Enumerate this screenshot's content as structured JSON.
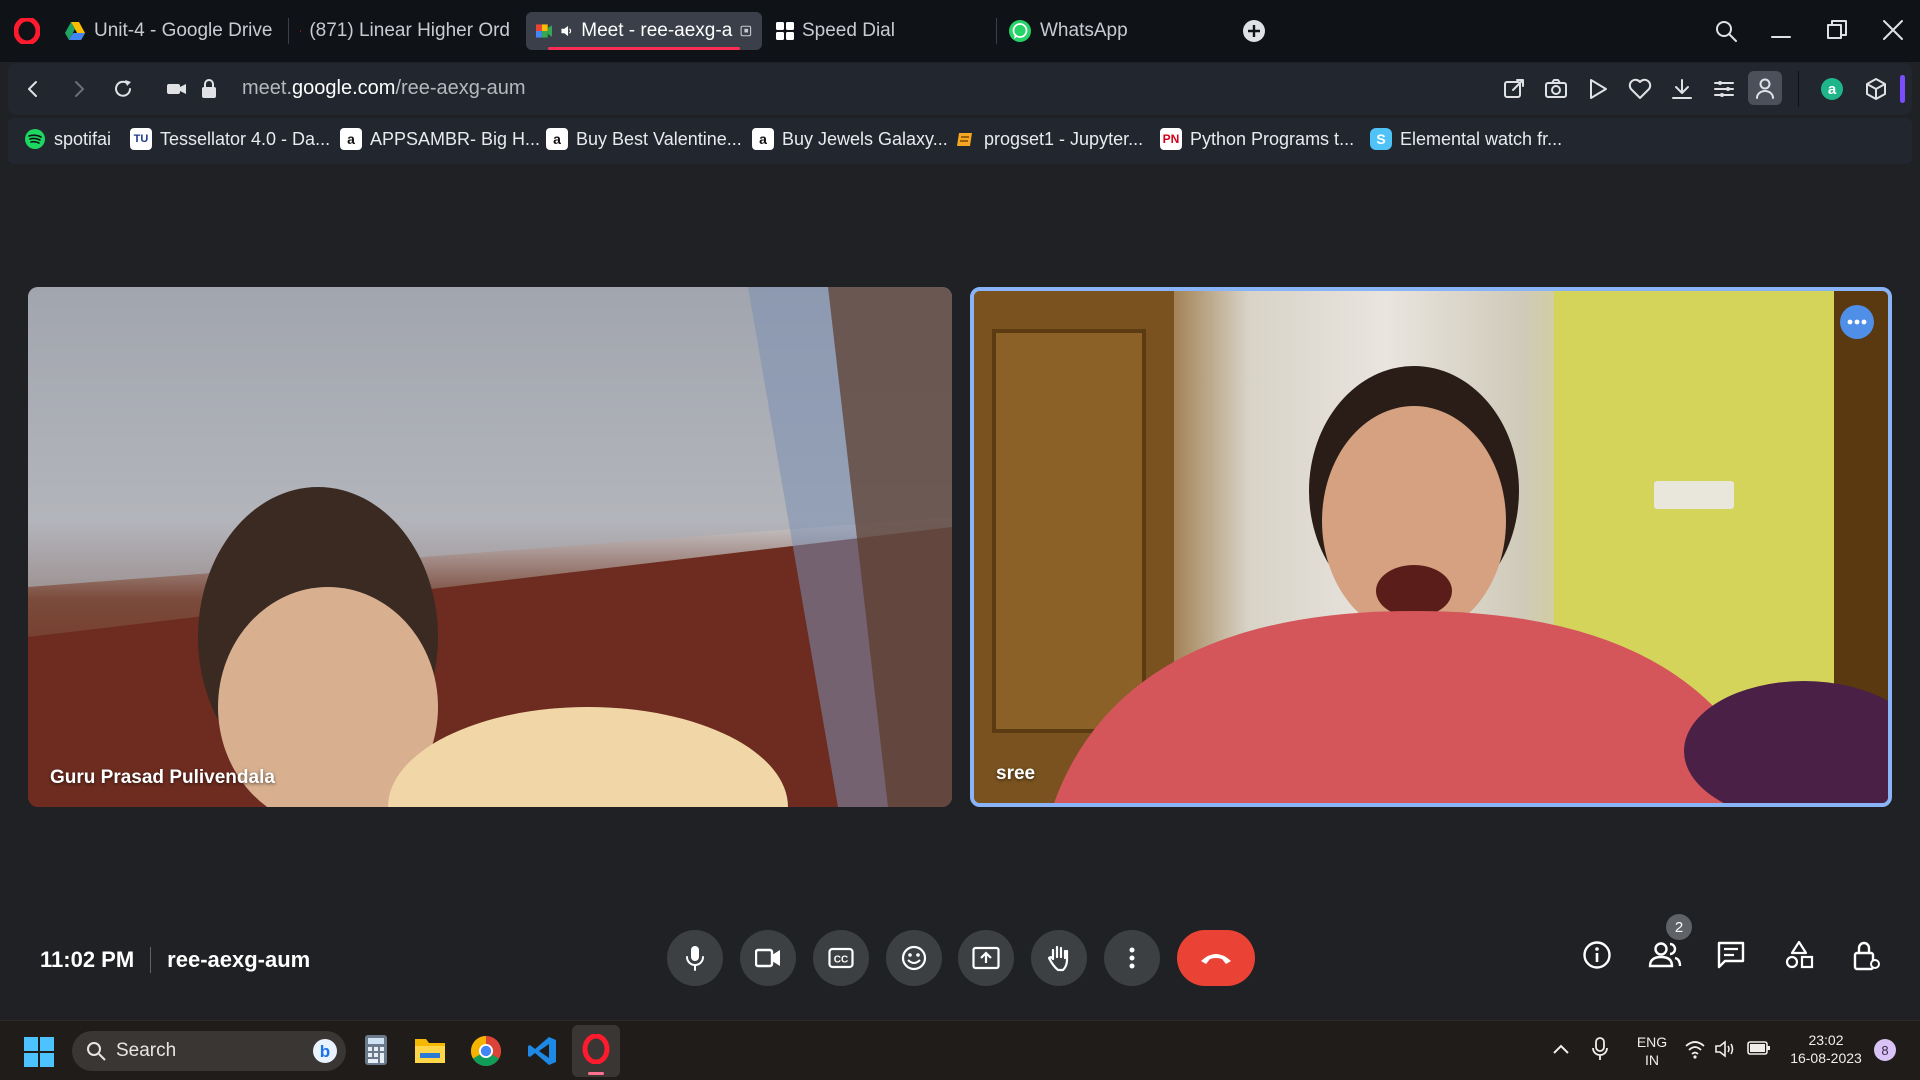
{
  "browser": {
    "tabs": [
      {
        "label": "Unit-4 - Google Drive",
        "icon": "google-drive-icon"
      },
      {
        "label": "(871) Linear Higher Ord",
        "icon": "youtube-icon"
      },
      {
        "label": "Meet - ree-aexg-a",
        "icon": "google-meet-icon",
        "active": true
      },
      {
        "label": "Speed Dial",
        "icon": "speed-dial-icon"
      },
      {
        "label": "WhatsApp",
        "icon": "whatsapp-icon"
      }
    ],
    "url_prefix": "meet.",
    "url_domain": "google.com",
    "url_path": "/ree-aexg-aum",
    "bookmarks": [
      {
        "label": "spotifai",
        "icon": "spotify-icon"
      },
      {
        "label": "Tessellator 4.0 - Da...",
        "icon": "tessellator-icon"
      },
      {
        "label": "APPSAMBR- Big H...",
        "icon": "amazon-icon"
      },
      {
        "label": "Buy Best Valentine...",
        "icon": "amazon-icon"
      },
      {
        "label": "Buy Jewels Galaxy...",
        "icon": "amazon-icon"
      },
      {
        "label": "progset1 - Jupyter...",
        "icon": "jupyter-icon"
      },
      {
        "label": "Python Programs t...",
        "icon": "python-programs-icon"
      },
      {
        "label": "Elemental watch fr...",
        "icon": "elemental-icon"
      }
    ]
  },
  "meet": {
    "participants": [
      {
        "name": "Guru Prasad Pulivendala"
      },
      {
        "name": "sree"
      }
    ],
    "time": "11:02 PM",
    "meeting_code": "ree-aexg-aum",
    "people_count": "2",
    "accent": "#8ab4f8",
    "end_call_color": "#ea4335"
  },
  "taskbar": {
    "search_placeholder": "Search",
    "lang_line1": "ENG",
    "lang_line2": "IN",
    "clock_time": "23:02",
    "clock_date": "16-08-2023",
    "notification_count": "8"
  }
}
